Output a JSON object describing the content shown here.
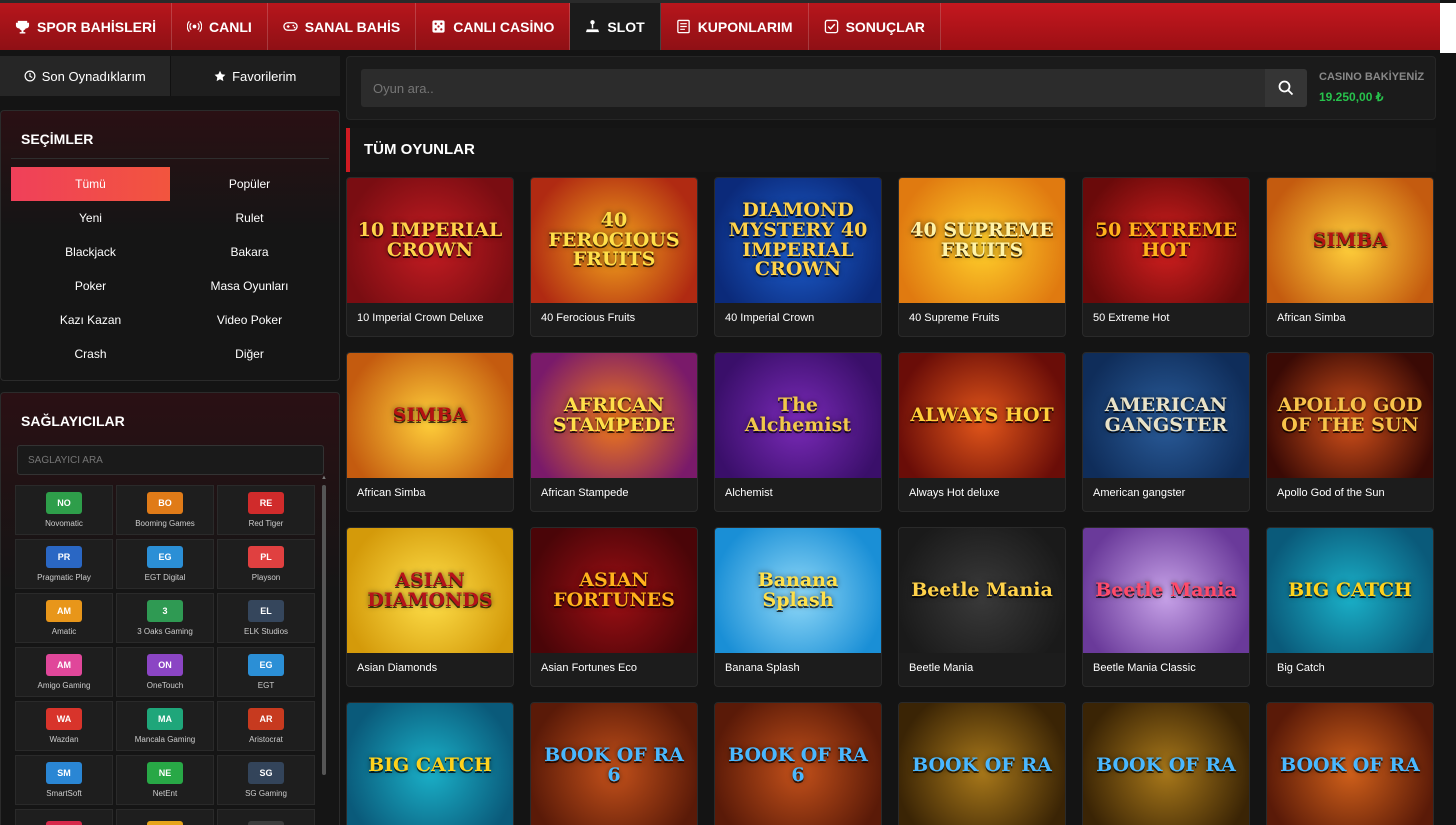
{
  "nav": [
    {
      "label": "SPOR BAHİSLERİ",
      "icon": "trophy-icon",
      "active": false
    },
    {
      "label": "CANLI",
      "icon": "live-broadcast-icon",
      "active": false
    },
    {
      "label": "SANAL BAHİS",
      "icon": "gamepad-icon",
      "active": false
    },
    {
      "label": "CANLI CASİNO",
      "icon": "dice-icon",
      "active": false
    },
    {
      "label": "SLOT",
      "icon": "joystick-icon",
      "active": true
    },
    {
      "label": "KUPONLARIM",
      "icon": "receipt-icon",
      "active": false
    },
    {
      "label": "SONUÇLAR",
      "icon": "checkbox-icon",
      "active": false
    }
  ],
  "sidebar": {
    "tabs": [
      {
        "label": "Son Oynadıklarım",
        "icon": "clock-icon"
      },
      {
        "label": "Favorilerim",
        "icon": "star-icon"
      }
    ],
    "selections_title": "SEÇİMLER",
    "categories": [
      {
        "label": "Tümü",
        "active": true
      },
      {
        "label": "Popüler",
        "active": false
      },
      {
        "label": "Yeni",
        "active": false
      },
      {
        "label": "Rulet",
        "active": false
      },
      {
        "label": "Blackjack",
        "active": false
      },
      {
        "label": "Bakara",
        "active": false
      },
      {
        "label": "Poker",
        "active": false
      },
      {
        "label": "Masa Oyunları",
        "active": false
      },
      {
        "label": "Kazı Kazan",
        "active": false
      },
      {
        "label": "Video Poker",
        "active": false
      },
      {
        "label": "Crash",
        "active": false
      },
      {
        "label": "Diğer",
        "active": false
      }
    ],
    "providers_title": "SAĞLAYICILAR",
    "provider_search_placeholder": "SAĞLAYICI ARA",
    "providers": [
      {
        "code": "NO",
        "name": "Novomatic",
        "color": "#2e9e4a"
      },
      {
        "code": "BO",
        "name": "Booming Games",
        "color": "#e07b18"
      },
      {
        "code": "RE",
        "name": "Red Tiger",
        "color": "#d02b2b"
      },
      {
        "code": "PR",
        "name": "Pragmatic Play",
        "color": "#2a67c4"
      },
      {
        "code": "EG",
        "name": "EGT Digital",
        "color": "#2b8fd6"
      },
      {
        "code": "PL",
        "name": "Playson",
        "color": "#e04040"
      },
      {
        "code": "AM",
        "name": "Amatic",
        "color": "#e8961a"
      },
      {
        "code": "3",
        "name": "3 Oaks Gaming",
        "color": "#2f9a53"
      },
      {
        "code": "EL",
        "name": "ELK Studios",
        "color": "#35465c"
      },
      {
        "code": "AM",
        "name": "Amigo Gaming",
        "color": "#e0479a"
      },
      {
        "code": "ON",
        "name": "OneTouch",
        "color": "#8b45c4"
      },
      {
        "code": "EG",
        "name": "EGT",
        "color": "#2b8fd6"
      },
      {
        "code": "WA",
        "name": "Wazdan",
        "color": "#d8342b"
      },
      {
        "code": "MA",
        "name": "Mancala Gaming",
        "color": "#1fa67a"
      },
      {
        "code": "AR",
        "name": "Aristocrat",
        "color": "#c73a1f"
      },
      {
        "code": "SM",
        "name": "SmartSoft",
        "color": "#2a86d4"
      },
      {
        "code": "NE",
        "name": "NetEnt",
        "color": "#28a846"
      },
      {
        "code": "SG",
        "name": "SG Gaming",
        "color": "#33445a"
      },
      {
        "code": "RU",
        "name": "",
        "color": "#d6294a"
      },
      {
        "code": "SA",
        "name": "",
        "color": "#e6a41a"
      },
      {
        "code": "TO",
        "name": "",
        "color": "#3c3c3c"
      }
    ]
  },
  "search": {
    "placeholder": "Oyun ara.."
  },
  "balance": {
    "label": "CASINO BAKİYENİZ",
    "value": "19.250,00 ₺"
  },
  "section_title": "TÜM OYUNLAR",
  "games": [
    {
      "name": "10 Imperial Crown Deluxe",
      "art": "10 IMPERIAL CROWN",
      "bg": "#7a0d12",
      "bg2": "#c41c22",
      "fg": "#ffd24a"
    },
    {
      "name": "40 Ferocious Fruits",
      "art": "40 FEROCIOUS FRUITS",
      "bg": "#b02a12",
      "bg2": "#f2a31c",
      "fg": "#ffe04a"
    },
    {
      "name": "40 Imperial Crown",
      "art": "DIAMOND MYSTERY 40 IMPERIAL CROWN",
      "bg": "#0b2a7a",
      "bg2": "#1d5fd0",
      "fg": "#ffd24a"
    },
    {
      "name": "40 Supreme Fruits",
      "art": "40 SUPREME FRUITS",
      "bg": "#e07a10",
      "bg2": "#ffcf2a",
      "fg": "#fff3a8"
    },
    {
      "name": "50 Extreme Hot",
      "art": "50 EXTREME HOT",
      "bg": "#6a0a0a",
      "bg2": "#d21f1f",
      "fg": "#ffb21c"
    },
    {
      "name": "African Simba",
      "art": "SIMBA",
      "bg": "#c45b0f",
      "bg2": "#ffcf3a",
      "fg": "#b51212"
    },
    {
      "name": "African Simba",
      "art": "SIMBA",
      "bg": "#c45b0f",
      "bg2": "#ffcf3a",
      "fg": "#b51212"
    },
    {
      "name": "African Stampede",
      "art": "AFRICAN STAMPEDE",
      "bg": "#7a1a6a",
      "bg2": "#f07a1a",
      "fg": "#ffe04a"
    },
    {
      "name": "Alchemist",
      "art": "The Alchemist",
      "bg": "#3a0f6a",
      "bg2": "#7a2ab8",
      "fg": "#f1c84a"
    },
    {
      "name": "Always Hot deluxe",
      "art": "ALWAYS HOT",
      "bg": "#6a0d08",
      "bg2": "#e2561a",
      "fg": "#ffcf3a"
    },
    {
      "name": "American gangster",
      "art": "AMERICAN GANGSTER",
      "bg": "#0f2d5a",
      "bg2": "#2a5c9a",
      "fg": "#e8e2c8"
    },
    {
      "name": "Apollo God of the Sun",
      "art": "APOLLO GOD OF THE SUN",
      "bg": "#3a0a05",
      "bg2": "#d2501a",
      "fg": "#f8c34a"
    },
    {
      "name": "Asian Diamonds",
      "art": "ASIAN DIAMONDS",
      "bg": "#d49a0a",
      "bg2": "#ffe04a",
      "fg": "#b5121a"
    },
    {
      "name": "Asian Fortunes Eco",
      "art": "ASIAN FORTUNES",
      "bg": "#4a0508",
      "bg2": "#9c0f14",
      "fg": "#ffb21c"
    },
    {
      "name": "Banana Splash",
      "art": "Banana Splash",
      "bg": "#1a8fd6",
      "bg2": "#8fd8f8",
      "fg": "#ffe04a"
    },
    {
      "name": "Beetle Mania",
      "art": "Beetle Mania",
      "bg": "#1a1a1a",
      "bg2": "#3a3a3a",
      "fg": "#ffd24a"
    },
    {
      "name": "Beetle Mania Classic",
      "art": "Beetle Mania",
      "bg": "#6a3a9a",
      "bg2": "#c7a2e8",
      "fg": "#ff4a6a"
    },
    {
      "name": "Big Catch",
      "art": "BIG CATCH",
      "bg": "#0a5a7a",
      "bg2": "#1ab0c8",
      "fg": "#ffd21c"
    },
    {
      "name": "",
      "art": "BIG CATCH",
      "bg": "#0a5a7a",
      "bg2": "#1ab0c8",
      "fg": "#ffd21c"
    },
    {
      "name": "",
      "art": "BOOK OF RA 6",
      "bg": "#5a1a08",
      "bg2": "#c2501a",
      "fg": "#4ab8ff"
    },
    {
      "name": "",
      "art": "BOOK OF RA 6",
      "bg": "#5a1a08",
      "bg2": "#c2501a",
      "fg": "#4ab8ff"
    },
    {
      "name": "",
      "art": "BOOK OF RA",
      "bg": "#3a2405",
      "bg2": "#a8781a",
      "fg": "#4ab8ff"
    },
    {
      "name": "",
      "art": "BOOK OF RA",
      "bg": "#3a2405",
      "bg2": "#a8781a",
      "fg": "#4ab8ff"
    },
    {
      "name": "",
      "art": "BOOK OF RA",
      "bg": "#5a1a08",
      "bg2": "#d0601a",
      "fg": "#4ab8ff"
    }
  ]
}
